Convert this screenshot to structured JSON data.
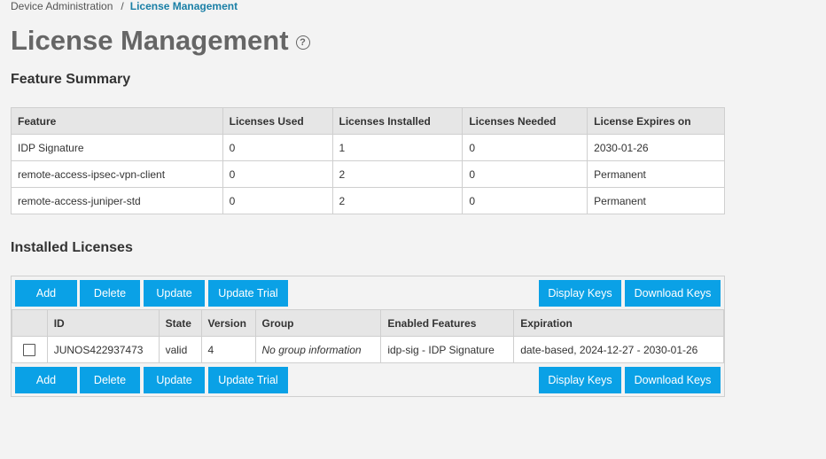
{
  "breadcrumb": {
    "parent": "Device Administration",
    "separator": "/",
    "current": "License Management"
  },
  "page": {
    "title": "License Management",
    "help_icon": "question-circle-icon"
  },
  "feature_summary": {
    "title": "Feature Summary",
    "columns": [
      "Feature",
      "Licenses Used",
      "Licenses Installed",
      "Licenses Needed",
      "License Expires on"
    ],
    "rows": [
      [
        "IDP Signature",
        "0",
        "1",
        "0",
        "2030-01-26"
      ],
      [
        "remote-access-ipsec-vpn-client",
        "0",
        "2",
        "0",
        "Permanent"
      ],
      [
        "remote-access-juniper-std",
        "0",
        "2",
        "0",
        "Permanent"
      ]
    ]
  },
  "installed_licenses": {
    "title": "Installed Licenses",
    "buttons": {
      "add": "Add",
      "delete": "Delete",
      "update": "Update",
      "update_trial": "Update Trial",
      "display_keys": "Display Keys",
      "download_keys": "Download Keys"
    },
    "columns": [
      "",
      "ID",
      "State",
      "Version",
      "Group",
      "Enabled Features",
      "Expiration"
    ],
    "rows": [
      {
        "id": "JUNOS422937473",
        "state": "valid",
        "version": "4",
        "group": "No group information",
        "enabled_features": "idp-sig - IDP Signature",
        "expiration": "date-based, 2024-12-27 - 2030-01-26"
      }
    ]
  },
  "colors": {
    "button": "#0aa1e6",
    "breadcrumb_current": "#1a7fa6",
    "header_bg": "#e6e6e6",
    "page_bg": "#f3f3f3"
  }
}
